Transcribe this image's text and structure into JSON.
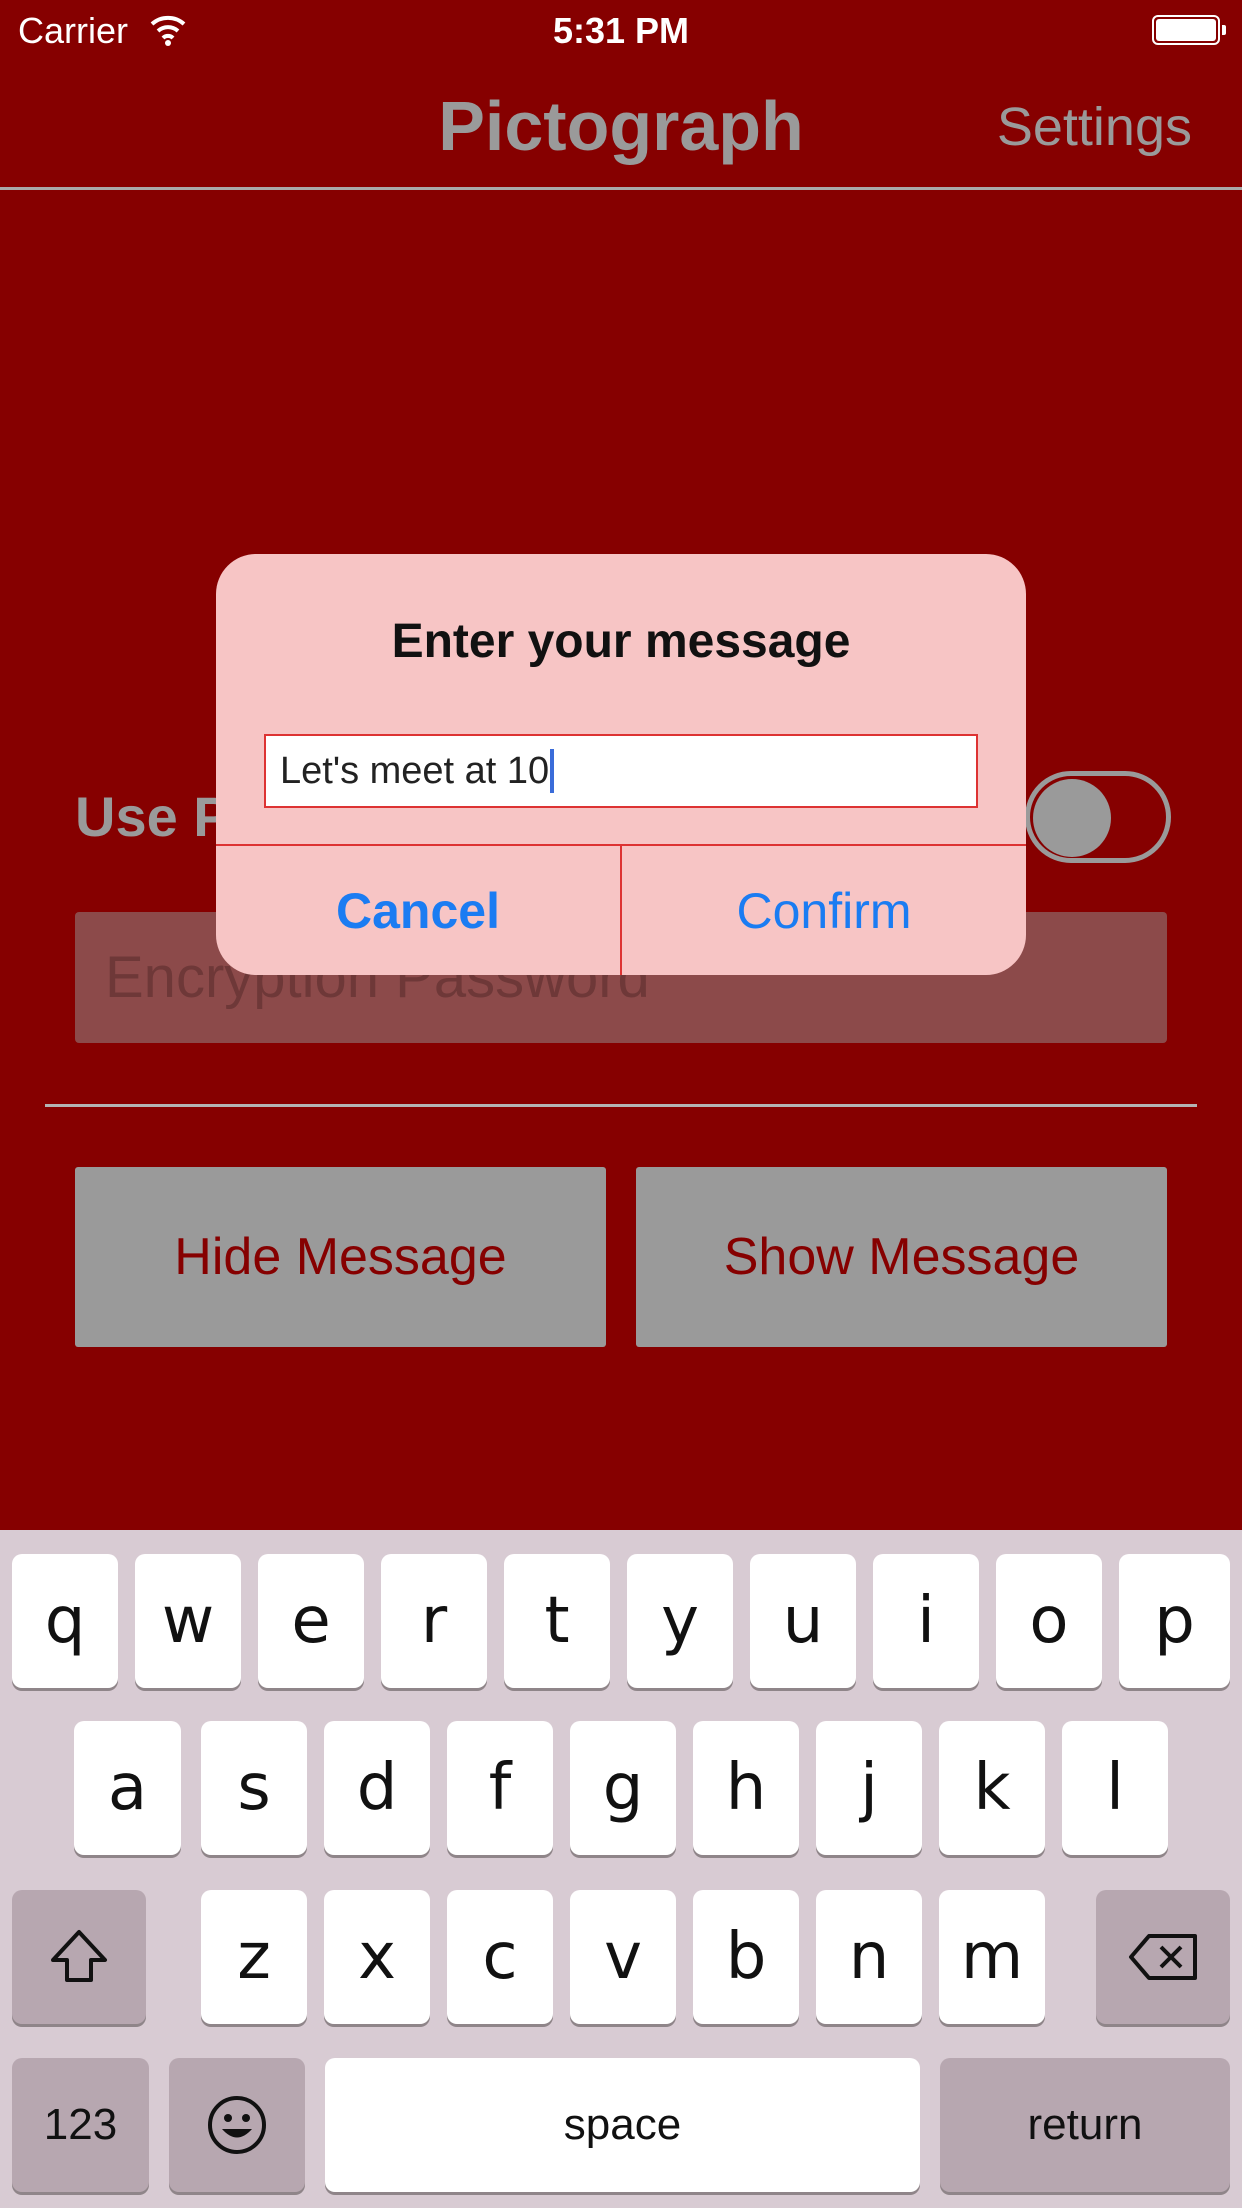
{
  "status_bar": {
    "carrier": "Carrier",
    "time": "5:31 PM"
  },
  "nav": {
    "title": "Pictograph",
    "settings": "Settings"
  },
  "content": {
    "use_password_label": "Use P",
    "password_placeholder": "Encryption Password",
    "hide_button": "Hide Message",
    "show_button": "Show Message"
  },
  "alert": {
    "title": "Enter your message",
    "input_value": "Let's meet at 10",
    "cancel": "Cancel",
    "confirm": "Confirm"
  },
  "keyboard": {
    "row1": [
      "q",
      "w",
      "e",
      "r",
      "t",
      "y",
      "u",
      "i",
      "o",
      "p"
    ],
    "row2": [
      "a",
      "s",
      "d",
      "f",
      "g",
      "h",
      "j",
      "k",
      "l"
    ],
    "row3": [
      "z",
      "x",
      "c",
      "v",
      "b",
      "n",
      "m"
    ],
    "numbers_key": "123",
    "space_key": "space",
    "return_key": "return"
  },
  "colors": {
    "background": "#860000",
    "accent": "#1b7cf2",
    "alert": "#f7c5c5"
  }
}
